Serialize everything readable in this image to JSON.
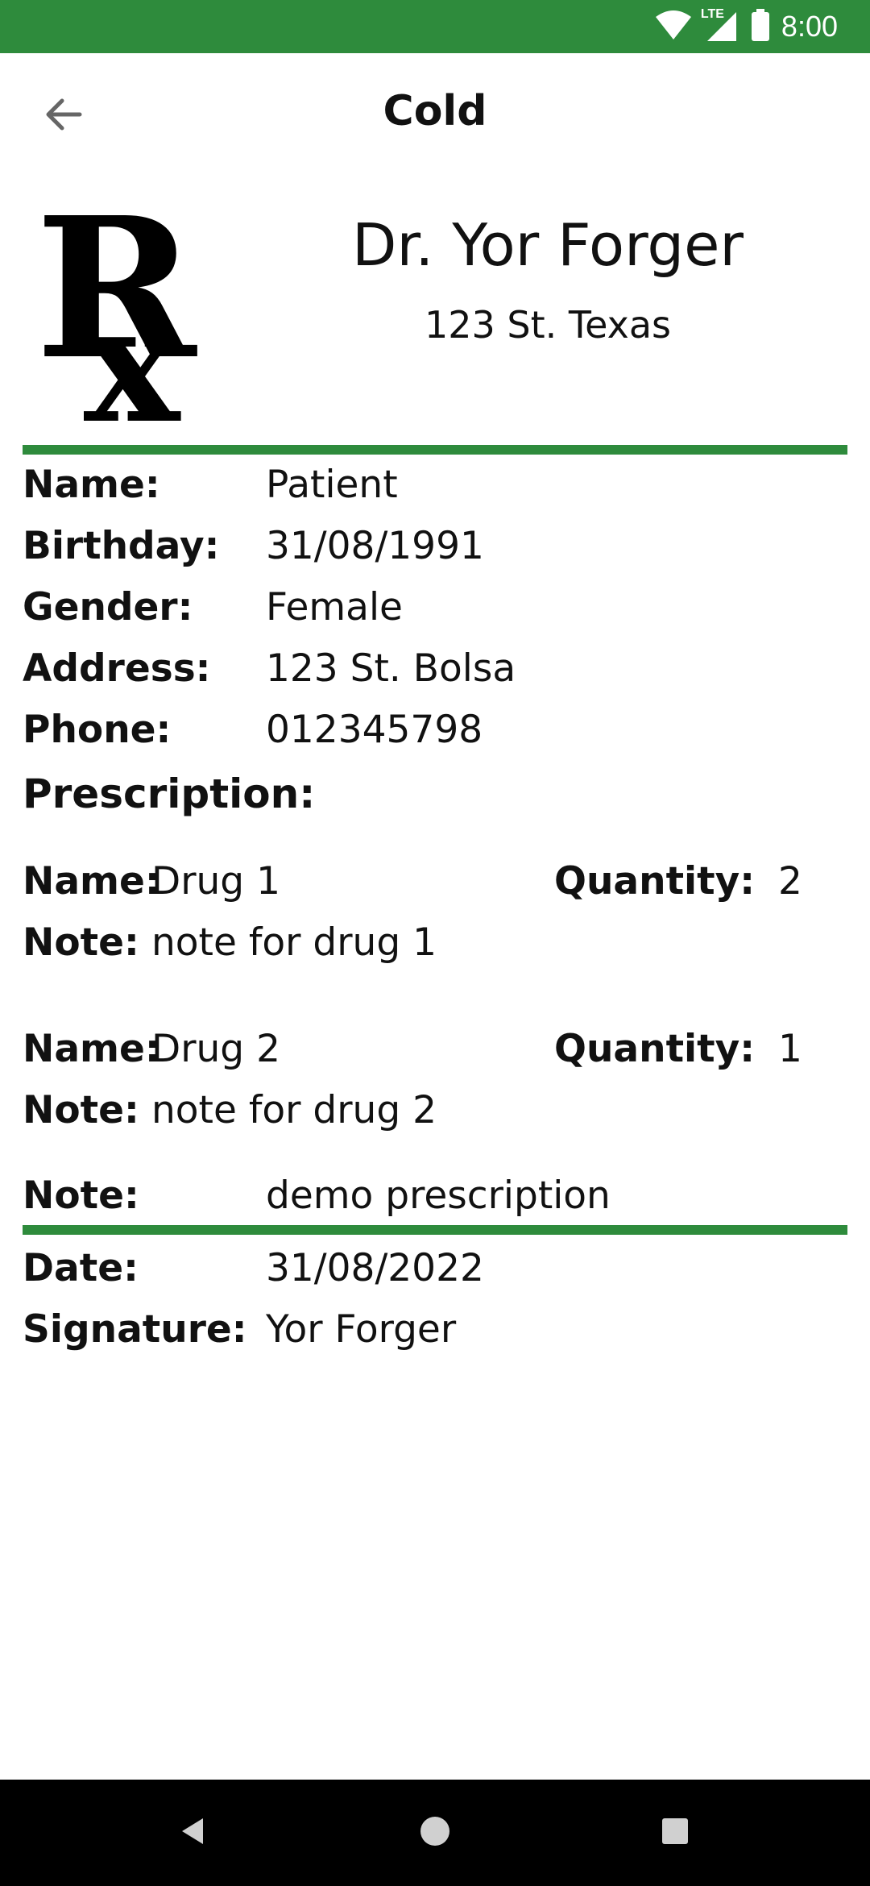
{
  "status_bar": {
    "time": "8:00",
    "network": "LTE",
    "icons": [
      "wifi-icon",
      "lte-signal-icon",
      "battery-icon"
    ]
  },
  "header": {
    "title": "Cold",
    "back_icon": "arrow-left-icon"
  },
  "doctor": {
    "name": "Dr. Yor Forger",
    "address": "123 St. Texas",
    "logo_icon": "rx-icon"
  },
  "patient": {
    "name_label": "Name:",
    "name_value": "Patient",
    "birthday_label": "Birthday:",
    "birthday_value": "31/08/1991",
    "gender_label": "Gender:",
    "gender_value": "Female",
    "address_label": "Address:",
    "address_value": "123 St. Bolsa",
    "phone_label": "Phone:",
    "phone_value": "012345798"
  },
  "prescription": {
    "title": "Prescription:",
    "drugs": [
      {
        "name_label": "Name:",
        "name": "Drug 1",
        "quantity_label": "Quantity:",
        "quantity": "2",
        "note_label": "Note:",
        "note": "note for drug 1"
      },
      {
        "name_label": "Name:",
        "name": "Drug 2",
        "quantity_label": "Quantity:",
        "quantity": "1",
        "note_label": "Note:",
        "note": "note for drug 2"
      }
    ],
    "note_label": "Note:",
    "note_value": "demo prescription"
  },
  "footer": {
    "date_label": "Date:",
    "date_value": "31/08/2022",
    "signature_label": "Signature:",
    "signature_value": "Yor Forger"
  },
  "colors": {
    "accent": "#2e8b3c",
    "nav_bar": "#000000",
    "text": "#111111"
  },
  "nav": {
    "icons": [
      "back-triangle-icon",
      "home-circle-icon",
      "recents-square-icon"
    ]
  }
}
